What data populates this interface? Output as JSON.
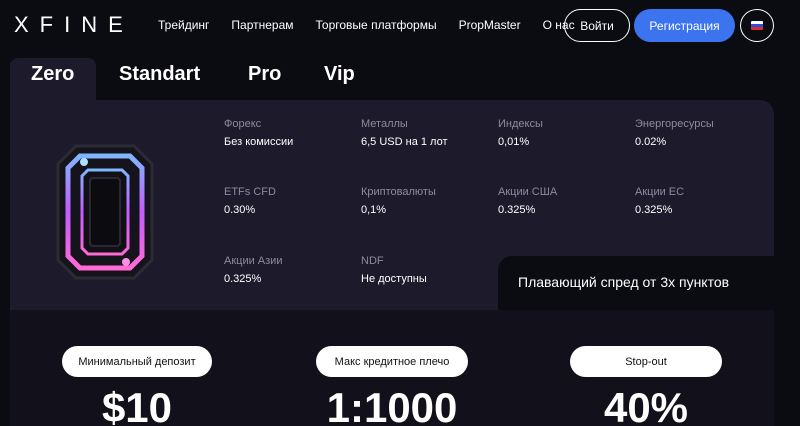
{
  "header": {
    "logo": "XFINE",
    "nav": [
      "Трейдинг",
      "Партнерам",
      "Торговые платформы",
      "PropMaster",
      "О нас"
    ],
    "login_label": "Войти",
    "register_label": "Регистрация",
    "language": "RU"
  },
  "tabs": [
    {
      "label": "Zero",
      "active": true
    },
    {
      "label": "Standart",
      "active": false
    },
    {
      "label": "Pro",
      "active": false
    },
    {
      "label": "Vip",
      "active": false
    }
  ],
  "instruments": [
    {
      "label": "Форекс",
      "value": "Без комиссии"
    },
    {
      "label": "Металлы",
      "value": "6,5 USD на 1 лот"
    },
    {
      "label": "Индексы",
      "value": "0,01%"
    },
    {
      "label": "Энергоресурсы",
      "value": "0.02%"
    },
    {
      "label": "ETFs CFD",
      "value": "0.30%"
    },
    {
      "label": "Криптовалюты",
      "value": "0,1%"
    },
    {
      "label": "Акции США",
      "value": "0.325%"
    },
    {
      "label": "Акции ЕС",
      "value": "0.325%"
    },
    {
      "label": "Акции Азии",
      "value": "0.325%"
    },
    {
      "label": "NDF",
      "value": "Не доступны"
    }
  ],
  "spread_text": "Плавающий спред от 3х пунктов",
  "stats": [
    {
      "label": "Минимальный депозит",
      "value": "$10"
    },
    {
      "label": "Макс кредитное плечо",
      "value": "1:1000"
    },
    {
      "label": "Stop-out",
      "value": "40%"
    }
  ],
  "colors": {
    "accent": "#3b74ee",
    "background": "#0b0b12",
    "card": "#1d1b2b",
    "muted_text": "#8e8c9c"
  }
}
